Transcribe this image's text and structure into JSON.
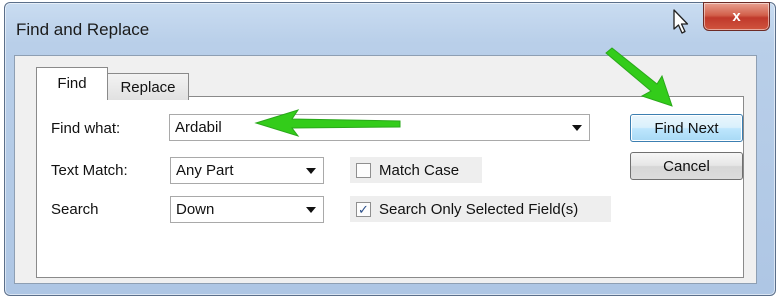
{
  "window": {
    "title": "Find and Replace",
    "close_glyph": "x"
  },
  "tabs": [
    {
      "label": "Find",
      "active": true
    },
    {
      "label": "Replace",
      "active": false
    }
  ],
  "form": {
    "find_what": {
      "label": "Find what:",
      "value": "Ardabil"
    },
    "text_match": {
      "label": "Text Match:",
      "value": "Any Part"
    },
    "search": {
      "label": "Search",
      "value": "Down"
    },
    "match_case": {
      "label": "Match Case",
      "checked": false
    },
    "search_only_selected": {
      "label": "Search Only Selected Field(s)",
      "checked": true
    }
  },
  "buttons": {
    "find_next": "Find Next",
    "cancel": "Cancel"
  },
  "colors": {
    "annotation_arrow": "#33cc1a",
    "title_bar": "#b9cfe9",
    "close_button": "#c0392b"
  },
  "icons": [
    "close-icon",
    "mouse-cursor-icon",
    "dropdown-arrow-icon",
    "checkmark-icon",
    "annotation-arrow"
  ]
}
